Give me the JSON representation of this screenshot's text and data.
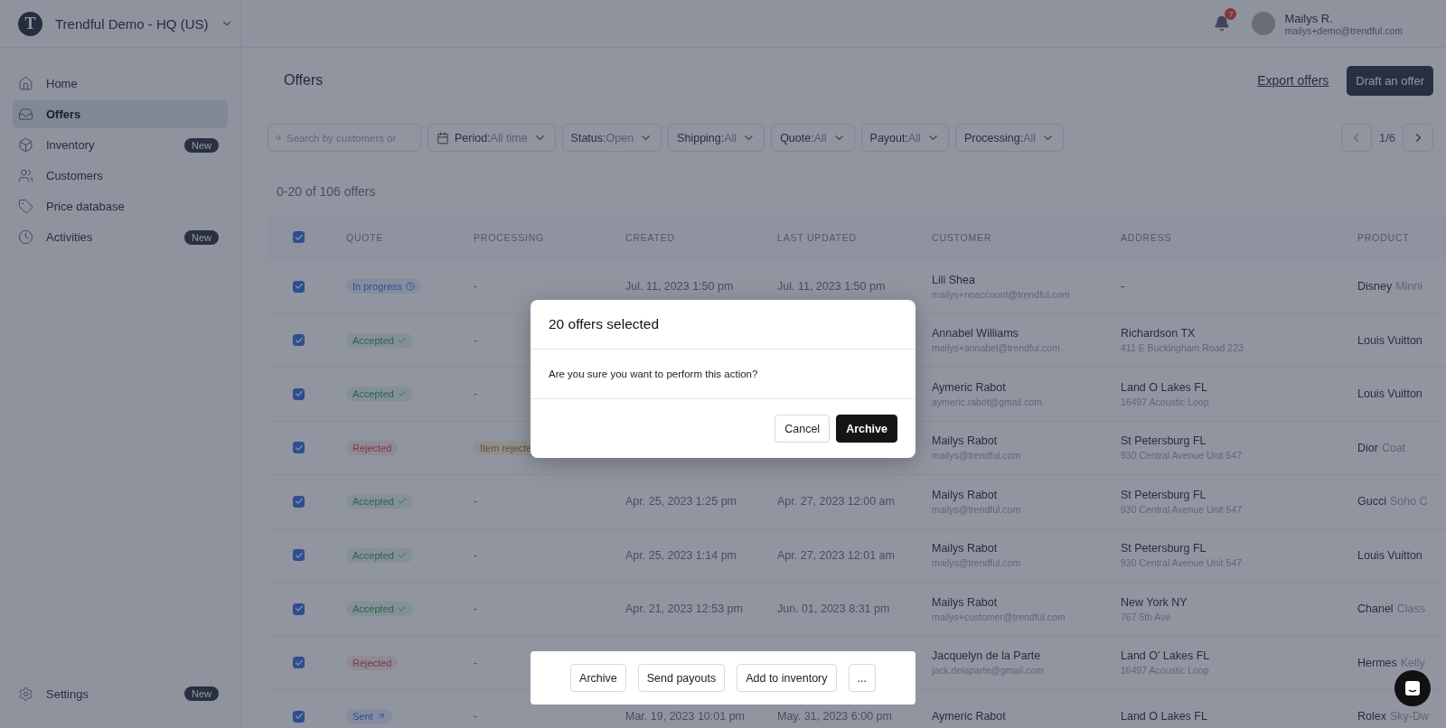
{
  "workspace": {
    "logo": "T",
    "name": "Trendful Demo - HQ (US)"
  },
  "topbar": {
    "notifications": "7",
    "user_name": "Mailys R.",
    "user_email": "mailys+demo@trendful.com"
  },
  "sidebar": {
    "items": [
      {
        "label": "Home",
        "selected": false
      },
      {
        "label": "Offers",
        "selected": true
      },
      {
        "label": "Inventory",
        "selected": false,
        "badge": "New"
      },
      {
        "label": "Customers",
        "selected": false
      },
      {
        "label": "Price database",
        "selected": false
      },
      {
        "label": "Activities",
        "selected": false,
        "badge": "New"
      }
    ],
    "footer": {
      "label": "Settings",
      "selected": false,
      "badge": "New"
    }
  },
  "page": {
    "title": "Offers",
    "export_link": "Export offers",
    "draft_button": "Draft an offer"
  },
  "filters": {
    "search_placeholder": "Search by customers or",
    "dropdowns": [
      {
        "label": "Period:",
        "value": "All time"
      },
      {
        "label": "Status:",
        "value": "Open"
      },
      {
        "label": "Shipping:",
        "value": "All"
      },
      {
        "label": "Quote:",
        "value": "All"
      },
      {
        "label": "Payout:",
        "value": "All"
      },
      {
        "label": "Processing:",
        "value": "All"
      }
    ],
    "pagination": "1/6"
  },
  "summary": "0-20 of 106 offers",
  "table": {
    "all_checked": true,
    "columns": [
      "QUOTE",
      "PROCESSING",
      "CREATED",
      "LAST UPDATED",
      "CUSTOMER",
      "ADDRESS",
      "PRODUCT"
    ],
    "rows": [
      {
        "checked": true,
        "quote": {
          "label": "In progress",
          "kind": "progress"
        },
        "processing": "-",
        "created": "Jul. 11, 2023 1:50 pm",
        "updated": "Jul. 11, 2023 1:50 pm",
        "customer": "Lili Shea",
        "email": "mailys+noaccount@trendful.com",
        "city": "-",
        "brand": "Disney",
        "model": "Minni"
      },
      {
        "checked": true,
        "quote": {
          "label": "Accepted",
          "kind": "accepted"
        },
        "processing": "-",
        "customer": "Annabel Williams",
        "email": "mailys+annabel@trendful.com",
        "city": "Richardson TX",
        "street": "411 E Buckingham Road 223",
        "brand": "Louis Vuitton"
      },
      {
        "checked": true,
        "quote": {
          "label": "Accepted",
          "kind": "accepted"
        },
        "processing": "-",
        "customer": "Aymeric Rabot",
        "email": "aymeric.rabot@gmail.com",
        "city": "Land O Lakes FL",
        "street": "16497 Acoustic Loop",
        "brand": "Louis Vuitton"
      },
      {
        "checked": true,
        "quote": {
          "label": "Rejected",
          "kind": "rejected"
        },
        "processing_badge": "Item rejecte",
        "customer": "Mailys Rabot",
        "email": "mailys@trendful.com",
        "city": "St Petersburg FL",
        "street": "930 Central Avenue Unit 547",
        "brand": "Dior",
        "model": "Coat"
      },
      {
        "checked": true,
        "quote": {
          "label": "Accepted",
          "kind": "accepted"
        },
        "processing": "-",
        "created": "Apr. 25, 2023 1:25 pm",
        "updated": "Apr. 27, 2023 12:00 am",
        "customer": "Mailys Rabot",
        "email": "mailys@trendful.com",
        "city": "St Petersburg FL",
        "street": "930 Central Avenue Unit 547",
        "brand": "Gucci",
        "model": "Soho C"
      },
      {
        "checked": true,
        "quote": {
          "label": "Accepted",
          "kind": "accepted"
        },
        "processing": "-",
        "created": "Apr. 25, 2023 1:14 pm",
        "updated": "Apr. 27, 2023 12:01 am",
        "customer": "Mailys Rabot",
        "email": "mailys@trendful.com",
        "city": "St Petersburg FL",
        "street": "930 Central Avenue Unit 547",
        "brand": "Louis Vuitton"
      },
      {
        "checked": true,
        "quote": {
          "label": "Accepted",
          "kind": "accepted"
        },
        "processing": "-",
        "created": "Apr. 21, 2023 12:53 pm",
        "updated": "Jun. 01, 2023 8:31 pm",
        "customer": "Mailys Rabot",
        "email": "mailys+customer@trendful.com",
        "city": "New York NY",
        "street": "767 5th Ave",
        "brand": "Chanel",
        "model": "Class"
      },
      {
        "checked": true,
        "quote": {
          "label": "Rejected",
          "kind": "rejected"
        },
        "processing": "-",
        "customer": "Jacquelyn de la Parte",
        "email": "jack.delaparte@gmail.com",
        "city": "Land O' Lakes FL",
        "street": "16497 Acoustic Loop",
        "brand": "Hermes",
        "model": "Kelly"
      },
      {
        "checked": true,
        "quote": {
          "label": "Sent",
          "kind": "sent"
        },
        "processing": "-",
        "created": "Mar. 19, 2023 10:01 pm",
        "updated": "May. 31, 2023 6:00 pm",
        "customer": "Aymeric Rabot",
        "city": "Land O Lakes FL",
        "brand": "Rolex",
        "model": "Sky-Dw"
      }
    ]
  },
  "dialog": {
    "title": "20 offers selected",
    "message": "Are you sure you want to perform this action?",
    "buttons": [
      {
        "label": "Cancel",
        "kind": "secondary"
      },
      {
        "label": "Archive",
        "kind": "primary"
      }
    ]
  },
  "action_bar": {
    "buttons": [
      "Archive",
      "Send payouts",
      "Add to inventory",
      "..."
    ]
  }
}
